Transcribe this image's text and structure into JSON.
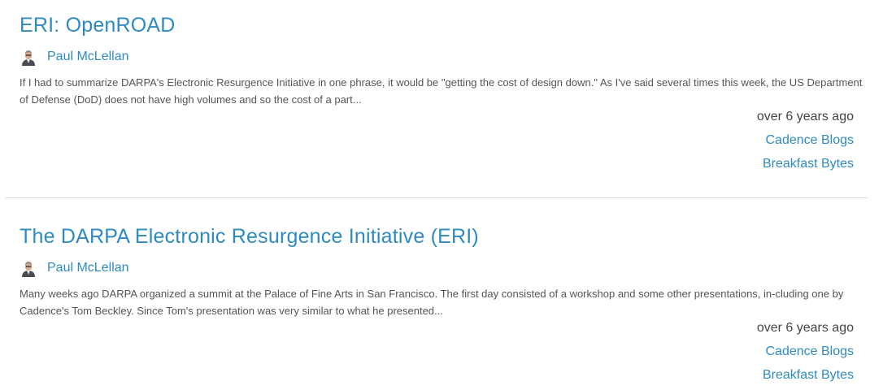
{
  "posts": [
    {
      "title": "ERI: OpenROAD",
      "author": "Paul McLellan",
      "excerpt": "If I had to summarize DARPA's Electronic Resurgence Initiative in one phrase, it would be \"getting the cost of design down.\" As I've said several times this week, the US Department of Defense (DoD) does not have high volumes and so the cost of a part...",
      "timestamp": "over 6 years ago",
      "tags": [
        "Cadence Blogs",
        "Breakfast Bytes"
      ]
    },
    {
      "title": "The DARPA Electronic Resurgence Initiative (ERI)",
      "author": "Paul McLellan",
      "excerpt": "Many weeks ago DARPA organized a summit at the Palace of Fine Arts in San Francisco. The first day consisted of a workshop and some other presentations, in-cluding one by Cadence's Tom Beckley. Since Tom's presentation was very similar to what he presented...",
      "timestamp": "over 6 years ago",
      "tags": [
        "Cadence Blogs",
        "Breakfast Bytes"
      ]
    }
  ],
  "colors": {
    "link": "#2e8bc0",
    "text": "#444444",
    "divider": "#dddddd"
  },
  "icons": {
    "avatar": "author-avatar-icon"
  }
}
